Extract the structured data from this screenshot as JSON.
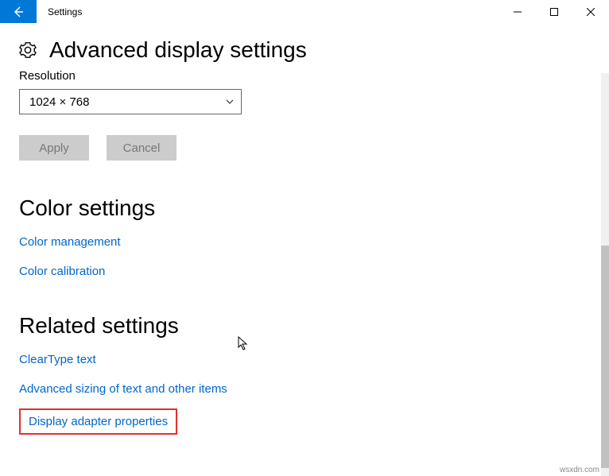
{
  "titlebar": {
    "title": "Settings"
  },
  "header": {
    "title": "Advanced display settings"
  },
  "resolution": {
    "label_truncated": "Resolution",
    "selected_value": "1024 × 768",
    "apply_label": "Apply",
    "cancel_label": "Cancel"
  },
  "sections": {
    "color": {
      "title": "Color settings",
      "links": [
        "Color management",
        "Color calibration"
      ]
    },
    "related": {
      "title": "Related settings",
      "links": [
        "ClearType text",
        "Advanced sizing of text and other items",
        "Display adapter properties"
      ]
    }
  },
  "watermark": "wsxdn.com"
}
